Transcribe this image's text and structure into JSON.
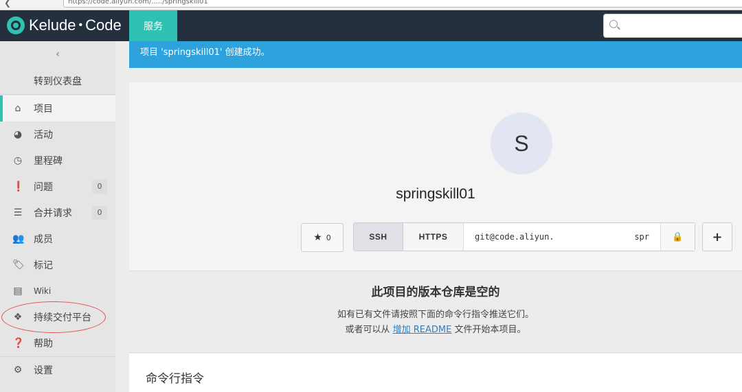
{
  "browser": {
    "back_glyph": "❮",
    "url": "https://code.aliyun.com/...../springskill01"
  },
  "topbar": {
    "logo_brand": "Kelude",
    "logo_dot": "•",
    "logo_code": "Code",
    "service_tab": "服务",
    "search_placeholder": ""
  },
  "sidebar": {
    "collapse_glyph": "‹",
    "dashboard_link": "转到仪表盘",
    "items": [
      {
        "label": "项目",
        "icon": "home-icon",
        "glyph": "⌂",
        "badge": ""
      },
      {
        "label": "活动",
        "icon": "dashboard-icon",
        "glyph": "◕",
        "badge": ""
      },
      {
        "label": "里程碑",
        "icon": "clock-icon",
        "glyph": "◷",
        "badge": ""
      },
      {
        "label": "问题",
        "icon": "exclamation-icon",
        "glyph": "❗",
        "badge": "0"
      },
      {
        "label": "合并请求",
        "icon": "merge-list-icon",
        "glyph": "☰",
        "badge": "0"
      },
      {
        "label": "成员",
        "icon": "users-icon",
        "glyph": "👥",
        "badge": ""
      },
      {
        "label": "标记",
        "icon": "tags-icon",
        "glyph": "🏷",
        "badge": ""
      },
      {
        "label": "Wiki",
        "icon": "book-icon",
        "glyph": "▤",
        "badge": ""
      },
      {
        "label": "持续交付平台",
        "icon": "cubes-icon",
        "glyph": "❖",
        "badge": ""
      },
      {
        "label": "帮助",
        "icon": "question-icon",
        "glyph": "❓",
        "badge": ""
      },
      {
        "label": "设置",
        "icon": "cogs-icon",
        "glyph": "⚙",
        "badge": ""
      }
    ]
  },
  "alert": {
    "message": "项目 'springskill01' 创建成功。"
  },
  "project": {
    "avatar_letter": "S",
    "name": "springskill01",
    "star_glyph": "★",
    "star_count": "0",
    "ssh_label": "SSH",
    "https_label": "HTTPS",
    "clone_url": "git@code.aliyun.",
    "clone_url_tail": "spr",
    "lock_glyph": "🔒",
    "plus_glyph": "+"
  },
  "empty_repo": {
    "title": "此项目的版本仓库是空的",
    "line1": "如有已有文件请按照下面的命令行指令推送它们。",
    "line2_prefix": "或者可以从",
    "line2_link": "增加 README",
    "line2_suffix": "文件开始本项目。"
  },
  "command_line": {
    "title": "命令行指令"
  }
}
